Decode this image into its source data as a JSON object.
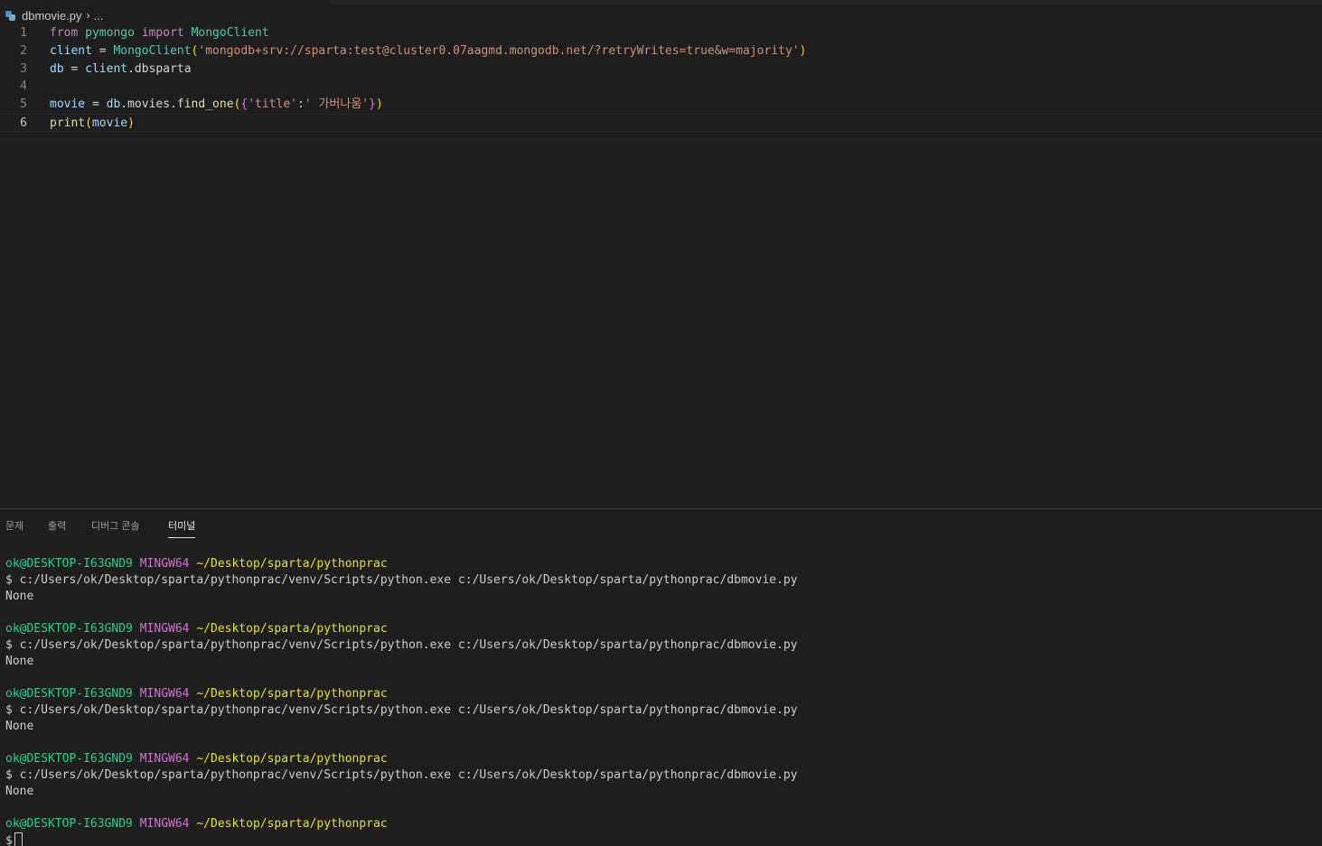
{
  "breadcrumb": {
    "file": "dbmovie.py",
    "separator": "›",
    "more": "..."
  },
  "editor": {
    "line_numbers": [
      "1",
      "2",
      "3",
      "4",
      "5",
      "6"
    ],
    "lines": [
      {
        "tokens": [
          {
            "t": "from",
            "c": "kw"
          },
          {
            "t": " ",
            "c": ""
          },
          {
            "t": "pymongo",
            "c": "mod"
          },
          {
            "t": " ",
            "c": ""
          },
          {
            "t": "import",
            "c": "kw"
          },
          {
            "t": " ",
            "c": ""
          },
          {
            "t": "MongoClient",
            "c": "mod"
          }
        ]
      },
      {
        "tokens": [
          {
            "t": "client",
            "c": "var"
          },
          {
            "t": " = ",
            "c": "op"
          },
          {
            "t": "MongoClient",
            "c": "mod"
          },
          {
            "t": "(",
            "c": "p1"
          },
          {
            "t": "'mongodb+srv://sparta:test@cluster0.07aagmd.mongodb.net/?retryWrites=true&w=majority'",
            "c": "str"
          },
          {
            "t": ")",
            "c": "p1"
          }
        ]
      },
      {
        "tokens": [
          {
            "t": "db",
            "c": "var"
          },
          {
            "t": " = ",
            "c": "op"
          },
          {
            "t": "client",
            "c": "var"
          },
          {
            "t": ".dbsparta",
            "c": "op"
          }
        ]
      },
      {
        "tokens": []
      },
      {
        "tokens": [
          {
            "t": "movie",
            "c": "var"
          },
          {
            "t": " = ",
            "c": "op"
          },
          {
            "t": "db",
            "c": "var"
          },
          {
            "t": ".movies.",
            "c": "op"
          },
          {
            "t": "find_one",
            "c": "fn"
          },
          {
            "t": "(",
            "c": "p1"
          },
          {
            "t": "{",
            "c": "p2"
          },
          {
            "t": "'title'",
            "c": "str"
          },
          {
            "t": ":",
            "c": "op"
          },
          {
            "t": "' 가버나움'",
            "c": "str"
          },
          {
            "t": "}",
            "c": "p2"
          },
          {
            "t": ")",
            "c": "p1"
          }
        ]
      },
      {
        "tokens": [
          {
            "t": "print",
            "c": "fn"
          },
          {
            "t": "(",
            "c": "p1"
          },
          {
            "t": "movie",
            "c": "var"
          },
          {
            "t": ")",
            "c": "p1"
          }
        ]
      }
    ],
    "current_line": 6
  },
  "panel": {
    "tabs": [
      {
        "label": "문제",
        "name": "tab-problems"
      },
      {
        "label": "출력",
        "name": "tab-output"
      },
      {
        "label": "디버그 콘솔",
        "name": "tab-debug-console"
      },
      {
        "label": "터미널",
        "name": "tab-terminal"
      }
    ],
    "active_tab": "터미널"
  },
  "terminal": {
    "user": "ok@DESKTOP-I63GND9",
    "system": "MINGW64",
    "cwd": "~/Desktop/sparta/pythonprac",
    "prompt": "$",
    "command": "c:/Users/ok/Desktop/sparta/pythonprac/venv/Scripts/python.exe c:/Users/ok/Desktop/sparta/pythonprac/dbmovie.py",
    "output": "None",
    "runs": 4
  }
}
